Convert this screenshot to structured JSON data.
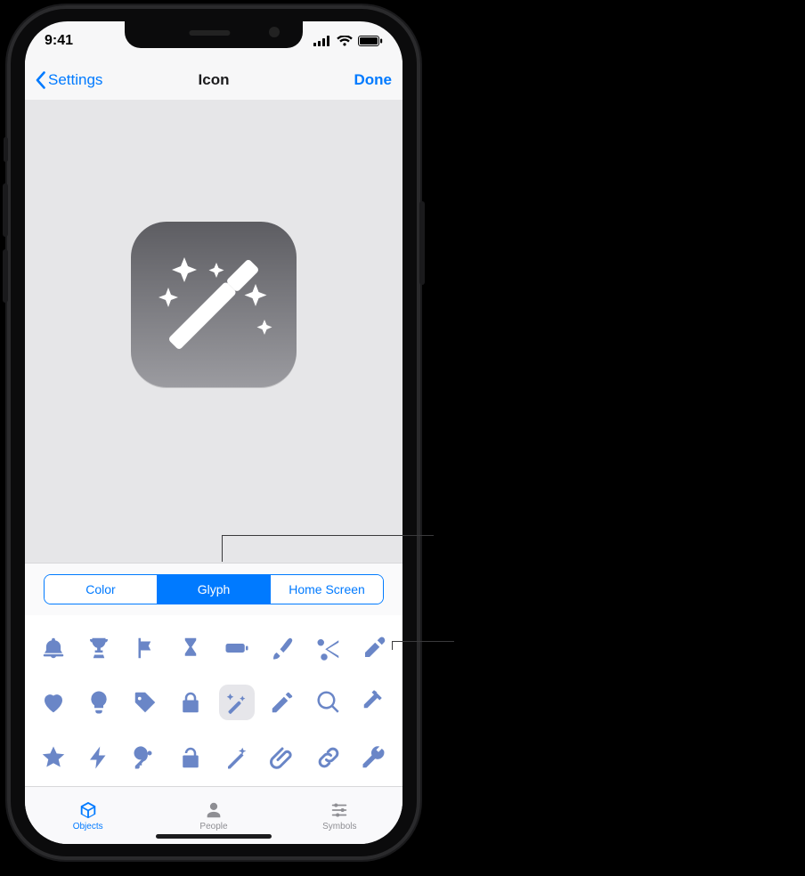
{
  "status": {
    "time": "9:41",
    "signal_icon": "cellular-signal-icon",
    "wifi_icon": "wifi-icon",
    "battery_icon": "battery-full-icon"
  },
  "nav": {
    "back_label": "Settings",
    "title": "Icon",
    "done_label": "Done"
  },
  "preview": {
    "glyph": "magic-wand-icon"
  },
  "segments": {
    "items": [
      "Color",
      "Glyph",
      "Home Screen"
    ],
    "selected_index": 1
  },
  "glyph_tabs": {
    "items": [
      "Objects",
      "People",
      "Symbols"
    ],
    "selected_index": 0
  },
  "glyph_grid": {
    "selected_index": 12,
    "icons": [
      "bell-icon",
      "trophy-icon",
      "flag-icon",
      "hourglass-icon",
      "battery-icon",
      "paintbrush-icon",
      "scissors-icon",
      "eyedropper-icon",
      "heart-icon",
      "lightbulb-icon",
      "tag-icon",
      "lock-icon",
      "magic-wand-icon",
      "pencil-icon",
      "magnifying-glass-icon",
      "hammer-icon",
      "star-icon",
      "bolt-icon",
      "key-icon",
      "unlock-icon",
      "wand-star-icon",
      "paperclip-icon",
      "link-icon",
      "wrench-icon"
    ]
  },
  "colors": {
    "accent": "#007aff",
    "glyph": "#6a86c7"
  }
}
